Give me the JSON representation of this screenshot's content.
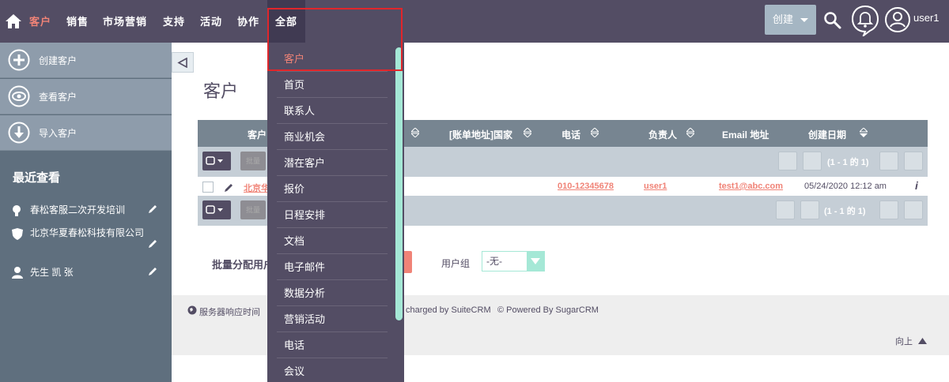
{
  "nav": {
    "items": [
      {
        "label": "客户",
        "active": true
      },
      {
        "label": "销售",
        "active": false
      },
      {
        "label": "市场营销",
        "active": false
      },
      {
        "label": "支持",
        "active": false
      },
      {
        "label": "活动",
        "active": false
      },
      {
        "label": "协作",
        "active": false
      },
      {
        "label": "全部",
        "active": false
      }
    ],
    "create_label": "创建",
    "user_label": "user1",
    "icons": [
      "home-icon",
      "search-icon",
      "bell-icon",
      "user-icon"
    ]
  },
  "sidebar": {
    "actions": [
      {
        "label": "创建客户",
        "icon": "plus-icon"
      },
      {
        "label": "查看客户",
        "icon": "eye-icon"
      },
      {
        "label": "导入客户",
        "icon": "import-icon"
      }
    ],
    "recent_title": "最近查看",
    "recent_items": [
      {
        "label": "春松客服二次开发培训",
        "icon": "lightbulb-icon"
      },
      {
        "label": "北京华夏春松科技有限公司",
        "icon": "shield-icon"
      },
      {
        "label": "先生 凯 张",
        "icon": "person-icon"
      }
    ]
  },
  "main": {
    "title": "客户",
    "columns": [
      "客户",
      "[账单地址]国家",
      "电话",
      "负责人",
      "Email 地址",
      "创建日期"
    ],
    "bulk_label": "批量",
    "pagination": "(1 - 1 的 1)",
    "row": {
      "name": "北京华",
      "phone": "010-12345678",
      "owner": "user1",
      "email": "test1@abc.com",
      "created": "05/24/2020 12:12 am",
      "info": "i"
    },
    "mass_assign_label": "批量分配用户",
    "usergroup_label": "用户组",
    "usergroup_value": "-无-"
  },
  "footer": {
    "response": "服务器响应时间",
    "supercharged": "charged by SuiteCRM",
    "powered": "© Powered By SugarCRM",
    "back_to_top": "向上"
  },
  "dropdown": {
    "items": [
      {
        "label": "客户",
        "active": true
      },
      {
        "label": "首页",
        "active": false
      },
      {
        "label": "联系人",
        "active": false
      },
      {
        "label": "商业机会",
        "active": false
      },
      {
        "label": "潜在客户",
        "active": false
      },
      {
        "label": "报价",
        "active": false
      },
      {
        "label": "日程安排",
        "active": false
      },
      {
        "label": "文档",
        "active": false
      },
      {
        "label": "电子邮件",
        "active": false
      },
      {
        "label": "数据分析",
        "active": false
      },
      {
        "label": "营销活动",
        "active": false
      },
      {
        "label": "电话",
        "active": false
      },
      {
        "label": "会议",
        "active": false
      }
    ]
  },
  "colors": {
    "nav_bg": "#534d64",
    "accent": "#f08377",
    "sidebar_bg": "#5f6f7e",
    "highlight": "#e0262b"
  }
}
